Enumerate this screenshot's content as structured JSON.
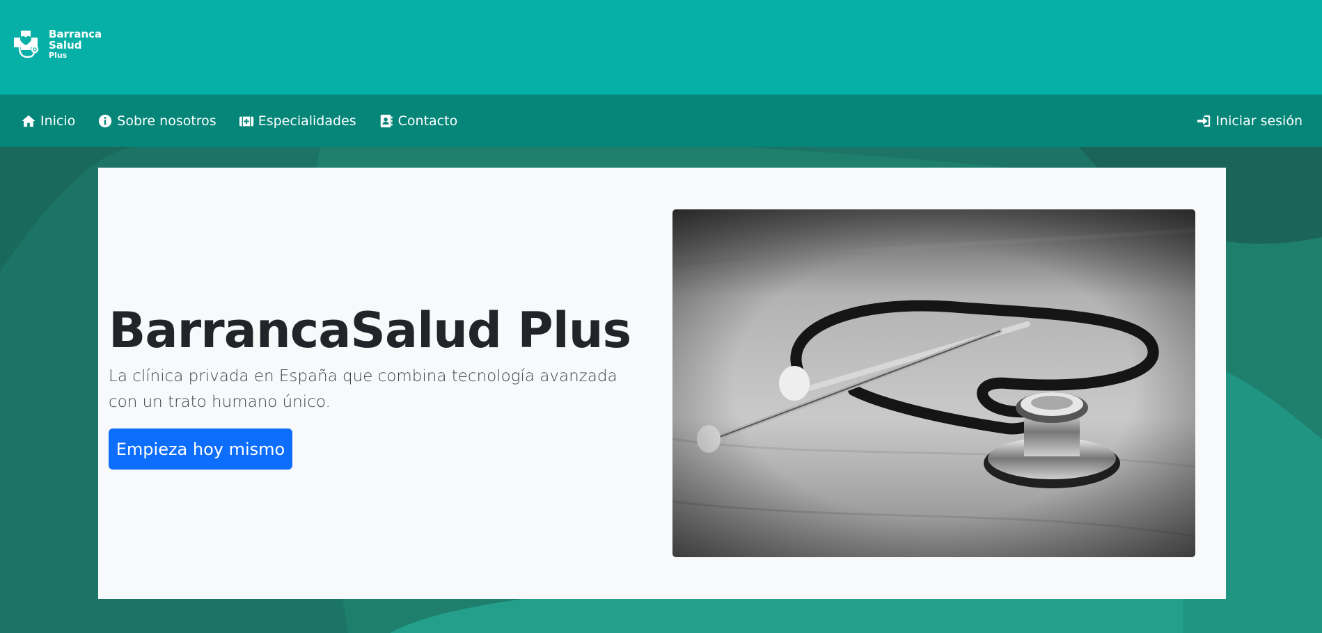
{
  "brand": {
    "line1": "Barranca",
    "line2": "Salud",
    "line3": "Plus",
    "color_primary": "#07b0a6",
    "color_nav": "#058679"
  },
  "nav": {
    "items": [
      {
        "label": "Inicio",
        "icon": "home-icon"
      },
      {
        "label": "Sobre nosotros",
        "icon": "info-circle-icon"
      },
      {
        "label": "Especialidades",
        "icon": "medical-kit-icon"
      },
      {
        "label": "Contacto",
        "icon": "address-book-icon"
      }
    ],
    "login_label": "Iniciar sesión",
    "login_icon": "sign-in-icon"
  },
  "hero": {
    "title": "BarrancaSalud Plus",
    "subtitle": "La clínica privada en España que combina tecnología avanzada con un trato humano único.",
    "button_label": "Empieza hoy mismo",
    "button_color": "#0d6efd",
    "image": "stethoscope-photo"
  }
}
